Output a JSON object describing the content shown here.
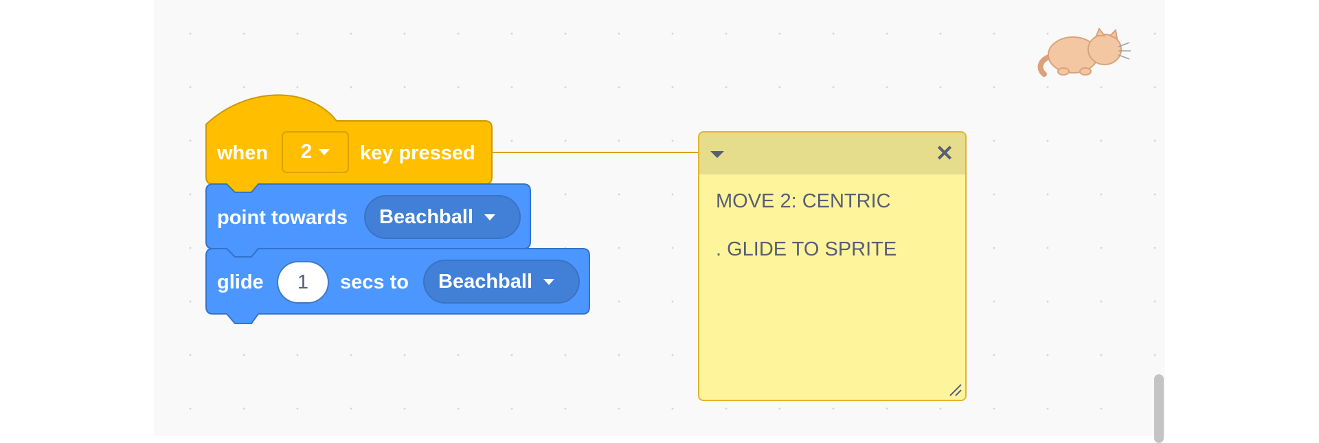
{
  "hat_block": {
    "prefix": "when",
    "key_value": "2",
    "suffix": "key pressed"
  },
  "point_block": {
    "label": "point towards",
    "target": "Beachball"
  },
  "glide_block": {
    "label": "glide",
    "seconds": "1",
    "middle_label": "secs to",
    "target": "Beachball"
  },
  "comment": {
    "lines": [
      "MOVE 2: CENTRIC",
      ". GLIDE TO SPRITE"
    ],
    "close_glyph": "✕"
  },
  "colors": {
    "events": "#ffbf00",
    "motion": "#4c97ff",
    "note": "#fef49c"
  },
  "icons": [
    "caret-down-icon",
    "close-icon",
    "minimize-icon",
    "resize-handle-icon",
    "sprite-cat-icon"
  ]
}
